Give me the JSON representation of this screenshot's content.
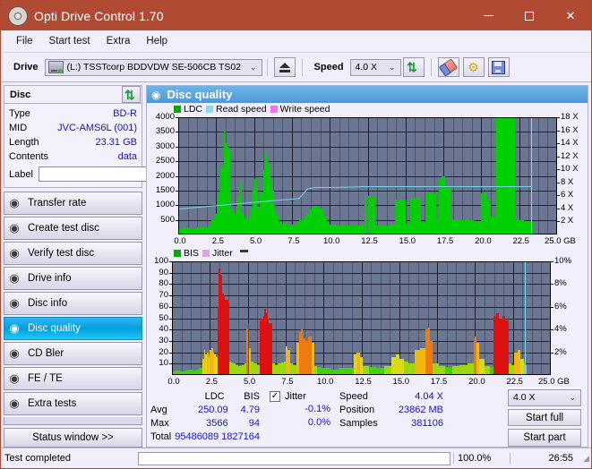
{
  "window": {
    "title": "Opti Drive Control 1.70",
    "icon": "disc-icon",
    "minimize": "–",
    "maximize": "□",
    "close": "✕"
  },
  "menu": [
    "File",
    "Start test",
    "Extra",
    "Help"
  ],
  "toolbar": {
    "drive_label": "Drive",
    "drive_value": "(L:)  TSSTcorp BDDVDW SE-506CB TS02",
    "eject_icon": "eject-icon",
    "speed_label": "Speed",
    "speed_value": "4.0 X",
    "refresh_icon": "refresh-icon",
    "erase_icon": "eraser-icon",
    "settings_icon": "gear-icon",
    "save_icon": "save-icon",
    "caret": "⌄"
  },
  "disc": {
    "header": "Disc",
    "refresh_icon": "refresh-icon",
    "fields": [
      {
        "key": "Type",
        "value": "BD-R"
      },
      {
        "key": "MID",
        "value": "JVC-AMS6L (001)"
      },
      {
        "key": "Length",
        "value": "23.31 GB"
      },
      {
        "key": "Contents",
        "value": "data"
      }
    ],
    "label_key": "Label",
    "label_value": "",
    "label_placeholder": "",
    "label_button_icon": "disc-icon"
  },
  "nav": {
    "items": [
      {
        "label": "Transfer rate",
        "icon": "disc-icon",
        "active": false
      },
      {
        "label": "Create test disc",
        "icon": "disc-icon",
        "active": false
      },
      {
        "label": "Verify test disc",
        "icon": "disc-icon",
        "active": false
      },
      {
        "label": "Drive info",
        "icon": "disc-icon",
        "active": false
      },
      {
        "label": "Disc info",
        "icon": "disc-icon",
        "active": false
      },
      {
        "label": "Disc quality",
        "icon": "disc-icon",
        "active": true
      },
      {
        "label": "CD Bler",
        "icon": "disc-icon",
        "active": false
      },
      {
        "label": "FE / TE",
        "icon": "disc-icon",
        "active": false
      },
      {
        "label": "Extra tests",
        "icon": "disc-icon",
        "active": false
      }
    ],
    "status_window": "Status window >>"
  },
  "panel": {
    "title": "Disc quality",
    "icon": "disc-icon"
  },
  "stats": {
    "col_headers": [
      "LDC",
      "BIS"
    ],
    "rows": [
      {
        "key": "Avg",
        "ldc": "250.09",
        "bis": "4.79"
      },
      {
        "key": "Max",
        "ldc": "3566",
        "bis": "94"
      },
      {
        "key": "Total",
        "ldc": "95486089",
        "bis": "1827164"
      }
    ],
    "jitter_label": "Jitter",
    "jitter_checked": true,
    "jitter_values": [
      "-0.1%",
      "0.0%"
    ],
    "speed_key": "Speed",
    "speed_value": "4.04 X",
    "position_key": "Position",
    "position_value": "23862 MB",
    "samples_key": "Samples",
    "samples_value": "381106",
    "speed_select": "4.0 X",
    "start_full": "Start full",
    "start_part": "Start part"
  },
  "statusbar": {
    "message": "Test completed",
    "percent_label": "100.0%",
    "percent": 100,
    "elapsed": "26:55"
  },
  "colors": {
    "titlebar": "#b04a33",
    "accent": "#009fe0",
    "ldc": "#00c000",
    "read_speed": "#79d3f0",
    "write_speed": "#ff6ef0",
    "bis": "#00a000",
    "jitter": "#d9a8dd",
    "plot_bg": "#6b7693",
    "progress": "#14b81e",
    "value_text": "#1414c8"
  },
  "chart_data": [
    {
      "type": "area",
      "id": "ldc-chart",
      "title": "Disc quality",
      "legend": [
        {
          "label": "LDC",
          "color": "#00c000"
        },
        {
          "label": "Read speed",
          "color": "#79d3f0"
        },
        {
          "label": "Write speed",
          "color": "#ff6ef0"
        }
      ],
      "legend_position": "top-left",
      "grid": true,
      "xlabel": "GB",
      "xlim": [
        0,
        25.0
      ],
      "xticks": [
        0.0,
        2.5,
        5.0,
        7.5,
        10.0,
        12.5,
        15.0,
        17.5,
        20.0,
        22.5,
        25.0
      ],
      "xticklabels": [
        "0.0",
        "2.5",
        "5.0",
        "7.5",
        "10.0",
        "12.5",
        "15.0",
        "17.5",
        "20.0",
        "22.5",
        "25.0 GB"
      ],
      "ylabel": "LDC",
      "ylim": [
        0,
        4000
      ],
      "yticks": [
        500,
        1000,
        1500,
        2000,
        2500,
        3000,
        3500,
        4000
      ],
      "yticklabels": [
        "500",
        "1000",
        "1500",
        "2000",
        "2500",
        "3000",
        "3500",
        "4000"
      ],
      "y2label": "Speed",
      "y2lim": [
        0,
        18
      ],
      "y2ticks": [
        2,
        4,
        6,
        8,
        10,
        12,
        14,
        16,
        18
      ],
      "y2ticklabels": [
        "2 X",
        "4 X",
        "6 X",
        "8 X",
        "10 X",
        "12 X",
        "14 X",
        "16 X",
        "18 X"
      ],
      "cursor_x": 23.3,
      "series": [
        {
          "name": "LDC",
          "color": "#00c000",
          "x": [
            0.0,
            0.2,
            0.4,
            0.6,
            0.8,
            1.0,
            1.2,
            1.4,
            1.6,
            1.8,
            2.0,
            2.2,
            2.4,
            2.6,
            2.8,
            3.0,
            3.1,
            3.2,
            3.3,
            3.4,
            3.5,
            3.6,
            3.7,
            3.8,
            3.9,
            4.0,
            4.2,
            4.4,
            4.5,
            4.6,
            4.7,
            4.8,
            4.9,
            5.0,
            5.2,
            5.4,
            5.6,
            5.7,
            5.8,
            5.9,
            6.0,
            6.1,
            6.2,
            6.3,
            6.4,
            6.6,
            6.8,
            7.0,
            7.2,
            7.4,
            7.6,
            7.8,
            8.0,
            8.2,
            8.4,
            8.6,
            8.8,
            9.0,
            9.2,
            9.4,
            9.6,
            9.8,
            10.0,
            10.5,
            11.0,
            11.5,
            12.0,
            12.3,
            12.5,
            13.0,
            13.5,
            14.0,
            14.3,
            14.6,
            15.0,
            15.3,
            15.6,
            16.0,
            16.3,
            16.6,
            17.0,
            17.2,
            17.4,
            17.6,
            18.0,
            18.5,
            19.0,
            19.5,
            20.0,
            20.2,
            20.4,
            20.6,
            21.0,
            21.3,
            21.6,
            21.9,
            22.0,
            22.2,
            22.4,
            22.6,
            22.8,
            23.0,
            23.2,
            23.3
          ],
          "y": [
            180,
            210,
            230,
            200,
            220,
            210,
            240,
            250,
            230,
            260,
            300,
            520,
            700,
            1400,
            2300,
            3566,
            3100,
            3000,
            2900,
            1400,
            900,
            760,
            700,
            900,
            1300,
            1800,
            700,
            520,
            600,
            560,
            700,
            900,
            1500,
            1900,
            900,
            1400,
            2200,
            2800,
            2600,
            2400,
            2200,
            1900,
            1500,
            1000,
            700,
            420,
            380,
            360,
            340,
            330,
            320,
            420,
            480,
            560,
            700,
            850,
            960,
            980,
            950,
            900,
            620,
            400,
            330,
            320,
            310,
            300,
            300,
            1300,
            1300,
            320,
            320,
            330,
            1200,
            1200,
            380,
            1250,
            1250,
            420,
            1400,
            1400,
            500,
            1900,
            2000,
            1600,
            520,
            500,
            480,
            470,
            1400,
            1400,
            1200,
            600,
            4000,
            6000,
            9000,
            11000,
            7000,
            520,
            500,
            480,
            470,
            460,
            450,
            420
          ]
        },
        {
          "name": "Read speed",
          "color": "#79d3f0",
          "x": [
            0.0,
            2.0,
            4.0,
            6.0,
            8.0,
            8.6,
            9.0,
            9.5,
            10.0,
            12.0,
            14.0,
            16.0,
            18.0,
            20.0,
            22.0,
            23.3
          ],
          "y": [
            4.0,
            4.4,
            4.8,
            5.2,
            5.6,
            7.2,
            7.3,
            7.3,
            7.3,
            7.4,
            7.4,
            7.4,
            7.4,
            7.4,
            7.4,
            7.4
          ]
        }
      ]
    },
    {
      "type": "area",
      "id": "bis-chart",
      "legend": [
        {
          "label": "BIS",
          "color": "#00a000"
        },
        {
          "label": "Jitter",
          "color": "#d9a8dd"
        }
      ],
      "legend_position": "top-left",
      "grid": true,
      "xlabel": "GB",
      "xlim": [
        0,
        25.0
      ],
      "xticks": [
        0.0,
        2.5,
        5.0,
        7.5,
        10.0,
        12.5,
        15.0,
        17.5,
        20.0,
        22.5,
        25.0
      ],
      "xticklabels": [
        "0.0",
        "2.5",
        "5.0",
        "7.5",
        "10.0",
        "12.5",
        "15.0",
        "17.5",
        "20.0",
        "22.5",
        "25.0 GB"
      ],
      "ylabel": "BIS",
      "ylim": [
        0,
        100
      ],
      "yticks": [
        10,
        20,
        30,
        40,
        50,
        60,
        70,
        80,
        90,
        100
      ],
      "yticklabels": [
        "10",
        "20",
        "30",
        "40",
        "50",
        "60",
        "70",
        "80",
        "90",
        "100"
      ],
      "y2label": "Jitter",
      "y2lim": [
        0,
        10
      ],
      "y2ticks": [
        2,
        4,
        6,
        8,
        10
      ],
      "y2ticklabels": [
        "2%",
        "4%",
        "6%",
        "8%",
        "10%"
      ],
      "cursor_x": 23.3,
      "series": [
        {
          "name": "BIS",
          "color_scale": [
            "#00c000",
            "#b8d400",
            "#f0a000",
            "#e02020"
          ],
          "x": [
            0.0,
            0.2,
            0.4,
            0.6,
            0.8,
            1.0,
            1.2,
            1.4,
            1.6,
            1.8,
            2.0,
            2.1,
            2.2,
            2.3,
            2.4,
            2.5,
            2.6,
            2.7,
            2.8,
            2.9,
            3.0,
            3.1,
            3.2,
            3.3,
            3.4,
            3.5,
            3.6,
            3.7,
            3.8,
            3.9,
            4.0,
            4.2,
            4.4,
            4.6,
            4.8,
            4.9,
            5.0,
            5.1,
            5.2,
            5.4,
            5.6,
            5.8,
            5.9,
            6.0,
            6.1,
            6.2,
            6.3,
            6.4,
            6.6,
            6.8,
            7.0,
            7.2,
            7.4,
            7.5,
            7.6,
            7.8,
            8.0,
            8.2,
            8.4,
            8.5,
            8.6,
            8.8,
            9.0,
            9.2,
            9.4,
            9.6,
            9.8,
            10.0,
            10.5,
            11.0,
            11.5,
            12.0,
            12.2,
            12.4,
            12.6,
            13.0,
            13.5,
            14.0,
            14.5,
            14.8,
            15.0,
            15.3,
            15.6,
            16.0,
            16.4,
            16.7,
            16.9,
            17.0,
            17.2,
            17.6,
            18.0,
            18.5,
            19.0,
            19.5,
            19.9,
            20.0,
            20.1,
            20.3,
            20.6,
            21.0,
            21.2,
            21.4,
            21.6,
            21.8,
            22.0,
            22.2,
            22.4,
            22.6,
            22.8,
            23.0,
            23.2,
            23.3
          ],
          "y": [
            3,
            4,
            4,
            3,
            4,
            5,
            5,
            4,
            5,
            6,
            14,
            22,
            18,
            20,
            16,
            22,
            24,
            20,
            18,
            16,
            60,
            94,
            88,
            72,
            70,
            66,
            66,
            64,
            12,
            11,
            10,
            9,
            8,
            9,
            10,
            40,
            46,
            24,
            12,
            10,
            9,
            48,
            50,
            52,
            58,
            54,
            50,
            46,
            10,
            9,
            10,
            11,
            12,
            25,
            22,
            10,
            9,
            28,
            38,
            40,
            32,
            30,
            34,
            28,
            8,
            7,
            6,
            6,
            5,
            6,
            6,
            18,
            20,
            16,
            8,
            7,
            6,
            8,
            16,
            18,
            14,
            12,
            10,
            22,
            24,
            40,
            42,
            30,
            10,
            8,
            7,
            8,
            9,
            10,
            30,
            34,
            28,
            14,
            8,
            7,
            52,
            54,
            50,
            52,
            48,
            10,
            9,
            20,
            22,
            14,
            10,
            9
          ]
        }
      ]
    }
  ]
}
